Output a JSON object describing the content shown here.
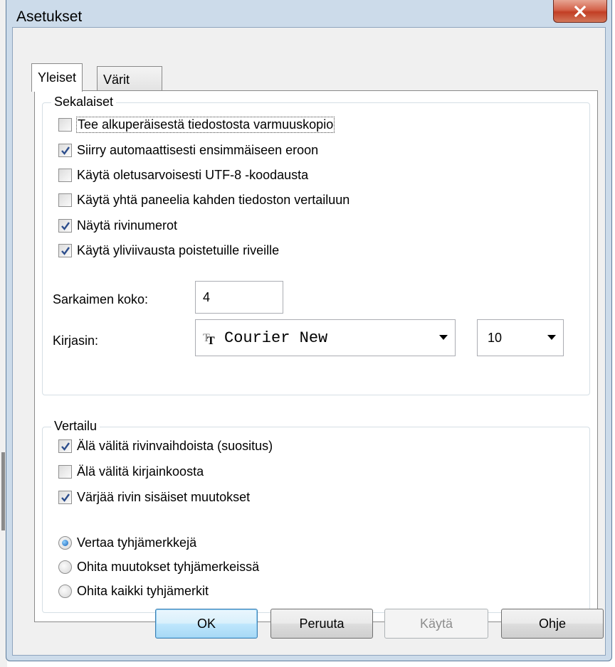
{
  "window": {
    "title": "Asetukset"
  },
  "tabs": [
    {
      "label": "Yleiset",
      "active": true
    },
    {
      "label": "Värit",
      "active": false
    }
  ],
  "misc_group": {
    "legend": "Sekalaiset",
    "checkboxes": [
      {
        "label": "Tee alkuperäisestä tiedostosta varmuuskopio",
        "checked": false
      },
      {
        "label": "Siirry automaattisesti ensimmäiseen eroon",
        "checked": true
      },
      {
        "label": "Käytä oletusarvoisesti UTF-8 -koodausta",
        "checked": false
      },
      {
        "label": "Käytä yhtä paneelia kahden tiedoston vertailuun",
        "checked": false
      },
      {
        "label": "Näytä rivinumerot",
        "checked": true
      },
      {
        "label": "Käytä yliviivausta poistetuille riveille",
        "checked": true
      }
    ],
    "tab_size": {
      "label": "Sarkaimen koko:",
      "value": "4"
    },
    "font": {
      "label": "Kirjasin:",
      "value": "Courier New",
      "size": "10"
    }
  },
  "compare_group": {
    "legend": "Vertailu",
    "checkboxes": [
      {
        "label": "Älä välitä rivinvaihdoista (suositus)",
        "checked": true
      },
      {
        "label": "Älä välitä kirjainkoosta",
        "checked": false
      },
      {
        "label": "Värjää rivin sisäiset muutokset",
        "checked": true
      }
    ],
    "radios": [
      {
        "label": "Vertaa tyhjämerkkejä",
        "selected": true
      },
      {
        "label": "Ohita muutokset tyhjämerkeissä",
        "selected": false
      },
      {
        "label": "Ohita kaikki tyhjämerkit",
        "selected": false
      }
    ]
  },
  "buttons": {
    "ok": "OK",
    "cancel": "Peruuta",
    "apply": "Käytä",
    "help": "Ohje"
  }
}
